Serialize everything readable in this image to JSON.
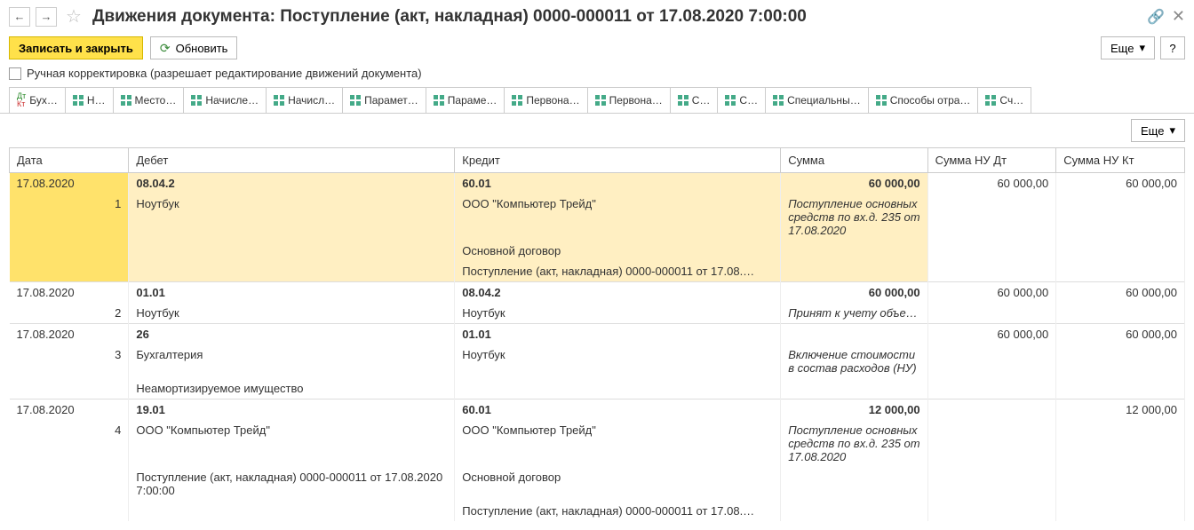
{
  "header": {
    "title": "Движения документа: Поступление (акт, накладная) 0000-000011 от 17.08.2020 7:00:00"
  },
  "toolbar": {
    "save_close": "Записать и закрыть",
    "refresh": "Обновить",
    "more": "Еще",
    "help": "?"
  },
  "checkbox": {
    "label": "Ручная корректировка (разрешает редактирование движений документа)"
  },
  "tabs": [
    {
      "label": "Бух…"
    },
    {
      "label": "Н…"
    },
    {
      "label": "Место…"
    },
    {
      "label": "Начисле…"
    },
    {
      "label": "Начисл…"
    },
    {
      "label": "Парамет…"
    },
    {
      "label": "Параме…"
    },
    {
      "label": "Первона…"
    },
    {
      "label": "Первона…"
    },
    {
      "label": "С…"
    },
    {
      "label": "С…"
    },
    {
      "label": "Специальны…"
    },
    {
      "label": "Способы отра…"
    },
    {
      "label": "Сч…"
    }
  ],
  "grid": {
    "headers": {
      "date": "Дата",
      "debit": "Дебет",
      "credit": "Кредит",
      "sum": "Сумма",
      "nud": "Сумма НУ Дт",
      "nuk": "Сумма НУ Кт"
    },
    "rows": [
      {
        "n": "1",
        "date": "17.08.2020",
        "debit_acc": "08.04.2",
        "credit_acc": "60.01",
        "sum": "60 000,00",
        "nud": "60 000,00",
        "nuk": "60 000,00",
        "debit_lines": [
          "Ноутбук"
        ],
        "credit_lines": [
          "ООО \"Компьютер Трейд\"",
          "Основной договор",
          "Поступление (акт, накладная) 0000-000011 от 17.08.…"
        ],
        "comment": "Поступление основных средств по вх.д. 235 от 17.08.2020",
        "selected": true
      },
      {
        "n": "2",
        "date": "17.08.2020",
        "debit_acc": "01.01",
        "credit_acc": "08.04.2",
        "sum": "60 000,00",
        "nud": "60 000,00",
        "nuk": "60 000,00",
        "debit_lines": [
          "Ноутбук"
        ],
        "credit_lines": [
          "Ноутбук"
        ],
        "comment": "Принят к учету объе…"
      },
      {
        "n": "3",
        "date": "17.08.2020",
        "debit_acc": "26",
        "credit_acc": "01.01",
        "sum": "",
        "nud": "60 000,00",
        "nuk": "60 000,00",
        "debit_lines": [
          "Бухгалтерия",
          "Неамортизируемое имущество"
        ],
        "credit_lines": [
          "Ноутбук"
        ],
        "comment": "Включение стоимости в состав расходов (НУ)"
      },
      {
        "n": "4",
        "date": "17.08.2020",
        "debit_acc": "19.01",
        "credit_acc": "60.01",
        "sum": "12 000,00",
        "nud": "",
        "nuk": "12 000,00",
        "debit_lines": [
          "ООО \"Компьютер Трейд\"",
          "Поступление (акт, накладная) 0000-000011 от 17.08.2020 7:00:00"
        ],
        "credit_lines": [
          "ООО \"Компьютер Трейд\"",
          "Основной договор",
          "Поступление (акт, накладная) 0000-000011 от 17.08.…"
        ],
        "comment": "Поступление основных средств по вх.д. 235 от 17.08.2020"
      }
    ]
  }
}
